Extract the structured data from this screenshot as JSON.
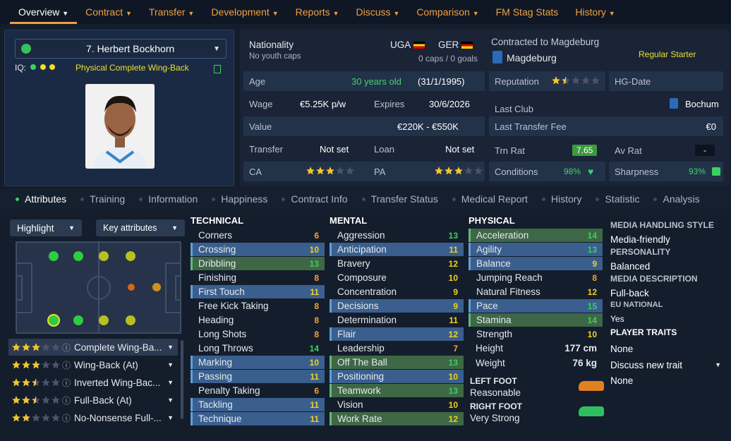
{
  "nav": {
    "tabs": [
      "Overview",
      "Contract",
      "Transfer",
      "Development",
      "Reports",
      "Discuss",
      "Comparison",
      "FM Stag Stats",
      "History"
    ]
  },
  "player": {
    "name": "7. Herbert Bockhorn",
    "iq_label": "IQ:",
    "role": "Physical Complete Wing-Back"
  },
  "nationality": {
    "label": "Nationality",
    "youth": "No youth caps",
    "nat1": "UGA",
    "nat2": "GER",
    "caps": "0 caps / 0 goals"
  },
  "contract": {
    "label": "Contracted to Magdeburg",
    "club": "Magdeburg",
    "status": "Regular Starter"
  },
  "age": {
    "label": "Age",
    "value": "30 years old",
    "dob": "(31/1/1995)"
  },
  "wage": {
    "label": "Wage",
    "value": "€5.25K p/w",
    "exp_label": "Expires",
    "exp_value": "30/6/2026"
  },
  "value": {
    "label": "Value",
    "value": "€220K - €550K"
  },
  "transfer": {
    "label": "Transfer",
    "value": "Not set",
    "loan_label": "Loan",
    "loan_value": "Not set"
  },
  "ca": {
    "label": "CA",
    "pa_label": "PA",
    "ca_stars": 3,
    "pa_stars": 3
  },
  "reputation": {
    "label": "Reputation",
    "stars": 1.5,
    "hg": "HG-Date"
  },
  "lastclub": {
    "label": "Last Club",
    "value": "Bochum"
  },
  "lastfee": {
    "label": "Last Transfer Fee",
    "value": "€0"
  },
  "trn": {
    "label": "Trn Rat",
    "value": "7.65",
    "avr_label": "Av Rat",
    "avr_value": "-"
  },
  "cond": {
    "label": "Conditions",
    "value": "98%",
    "sharp_label": "Sharpness",
    "sharp_value": "93%"
  },
  "ptabs": [
    "Attributes",
    "Training",
    "Information",
    "Happiness",
    "Contract Info",
    "Transfer Status",
    "Medical Report",
    "History",
    "Statistic",
    "Analysis"
  ],
  "controls": {
    "highlight": "Highlight",
    "key": "Key attributes"
  },
  "technical": {
    "title": "TECHNICAL",
    "rows": [
      [
        "Corners",
        "6"
      ],
      [
        "Crossing",
        "10"
      ],
      [
        "Dribbling",
        "13"
      ],
      [
        "Finishing",
        "8"
      ],
      [
        "First Touch",
        "11"
      ],
      [
        "Free Kick Taking",
        "8"
      ],
      [
        "Heading",
        "8"
      ],
      [
        "Long Shots",
        "8"
      ],
      [
        "Long Throws",
        "14"
      ],
      [
        "Marking",
        "10"
      ],
      [
        "Passing",
        "11"
      ],
      [
        "Penalty Taking",
        "6"
      ],
      [
        "Tackling",
        "11"
      ],
      [
        "Technique",
        "11"
      ]
    ]
  },
  "mental": {
    "title": "MENTAL",
    "rows": [
      [
        "Aggression",
        "13"
      ],
      [
        "Anticipation",
        "11"
      ],
      [
        "Bravery",
        "12"
      ],
      [
        "Composure",
        "10"
      ],
      [
        "Concentration",
        "9"
      ],
      [
        "Decisions",
        "9"
      ],
      [
        "Determination",
        "11"
      ],
      [
        "Flair",
        "12"
      ],
      [
        "Leadership",
        "7"
      ],
      [
        "Off The Ball",
        "13"
      ],
      [
        "Positioning",
        "10"
      ],
      [
        "Teamwork",
        "13"
      ],
      [
        "Vision",
        "10"
      ],
      [
        "Work Rate",
        "12"
      ]
    ]
  },
  "physical": {
    "title": "PHYSICAL",
    "rows": [
      [
        "Acceleration",
        "14"
      ],
      [
        "Agility",
        "13"
      ],
      [
        "Balance",
        "9"
      ],
      [
        "Jumping Reach",
        "8"
      ],
      [
        "Natural Fitness",
        "12"
      ],
      [
        "Pace",
        "15"
      ],
      [
        "Stamina",
        "14"
      ],
      [
        "Strength",
        "10"
      ]
    ],
    "height_label": "Height",
    "height": "177 cm",
    "weight_label": "Weight",
    "weight": "76 kg",
    "lf_label": "LEFT FOOT",
    "lf": "Reasonable",
    "rf_label": "RIGHT FOOT",
    "rf": "Very Strong"
  },
  "side": {
    "mhs_h": "MEDIA HANDLING STYLE",
    "mhs": "Media-friendly",
    "pers_h": "PERSONALITY",
    "pers": "Balanced",
    "md_h": "MEDIA DESCRIPTION",
    "md": "Full-back",
    "eu_h": "EU NATIONAL",
    "eu": "Yes",
    "traits_h": "PLAYER TRAITS",
    "traits": "None",
    "discuss": "Discuss new trait",
    "none2": "None"
  },
  "roles": [
    {
      "name": "Complete Wing-Ba...",
      "stars": 3
    },
    {
      "name": "Wing-Back (At)",
      "stars": 3
    },
    {
      "name": "Inverted Wing-Bac...",
      "stars": 2.5
    },
    {
      "name": "Full-Back (At)",
      "stars": 2.5
    },
    {
      "name": "No-Nonsense Full-...",
      "stars": 2
    }
  ],
  "colors": {
    "accent": "#f0a040",
    "good": "#3cd060",
    "mid": "#f0d020"
  }
}
